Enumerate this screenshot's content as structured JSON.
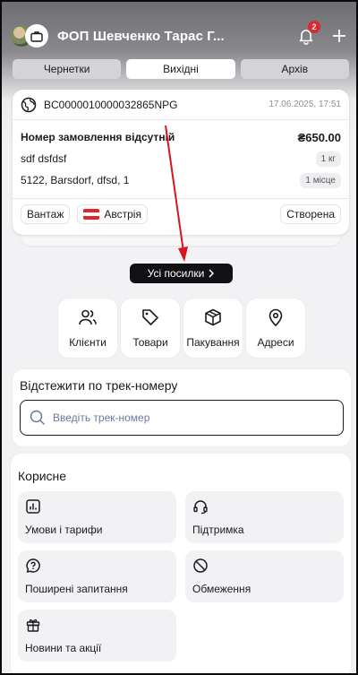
{
  "header": {
    "company_name": "ФОП Шевченко Тарас Г...",
    "notification_count": "2",
    "avatar_icon": "user-photo-icon",
    "briefcase_icon": "briefcase-icon",
    "bell_icon": "bell-icon",
    "add_icon": "plus-icon"
  },
  "tabs": [
    {
      "label": "Чернетки",
      "active": false
    },
    {
      "label": "Вихідні",
      "active": true
    },
    {
      "label": "Архів",
      "active": false
    }
  ],
  "shipment": {
    "tracking_number": "BC0000010000032865NPG",
    "date": "17.06.2025, 17:51",
    "order_title": "Номер замовлення відсутній",
    "price": "₴650.00",
    "description": "sdf dsfdsf",
    "weight": "1 кг",
    "address": "5122, Barsdorf, dfsd, 1",
    "places": "1 місце",
    "type_chip": "Вантаж",
    "country": "Австрія",
    "status": "Створена"
  },
  "all_parcels_button": "Усі посилки",
  "quick_actions": [
    {
      "label": "Клієнти",
      "icon": "users-icon"
    },
    {
      "label": "Товари",
      "icon": "tag-icon"
    },
    {
      "label": "Пакування",
      "icon": "box-icon"
    },
    {
      "label": "Адреси",
      "icon": "map-pin-icon"
    }
  ],
  "tracking": {
    "title": "Відстежити по трек-номеру",
    "placeholder": "Введіть трек-номер",
    "value": ""
  },
  "useful": {
    "title": "Корисне",
    "items": [
      {
        "label": "Умови і тарифи",
        "icon": "chart-icon"
      },
      {
        "label": "Підтримка",
        "icon": "headset-icon"
      },
      {
        "label": "Поширені запитання",
        "icon": "question-bubble-icon"
      },
      {
        "label": "Обмеження",
        "icon": "prohibited-icon"
      },
      {
        "label": "Новини та акції",
        "icon": "gift-icon"
      }
    ]
  },
  "colors": {
    "accent_dark": "#111114",
    "badge_red": "#e0262f",
    "annotation_arrow": "#d3171c"
  }
}
